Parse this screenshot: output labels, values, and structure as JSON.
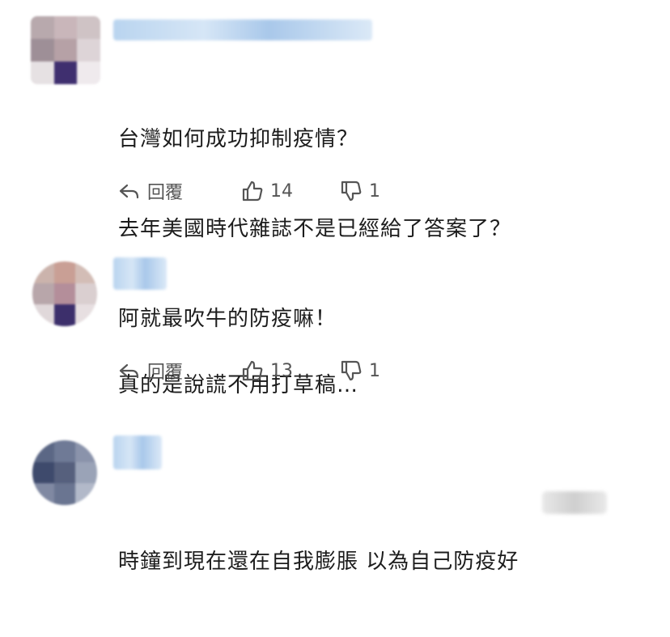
{
  "actions_text": {
    "reply": "回覆"
  },
  "comments": [
    {
      "lines": [
        "台灣如何成功抑制疫情？",
        "去年美國時代雜誌不是已經給了答案了？",
        "阿就最吹牛的防疫嘛！"
      ],
      "likes": "14",
      "dislikes": "1"
    },
    {
      "lines": [
        "真的是說謊不用打草稿…"
      ],
      "likes": "13",
      "dislikes": "1"
    },
    {
      "lines": [
        "時鐘到現在還在自我膨脹 以為自己防疫好"
      ]
    }
  ],
  "colors": {
    "action_gray": "#555555",
    "name_blur": "#b9d4ef"
  }
}
